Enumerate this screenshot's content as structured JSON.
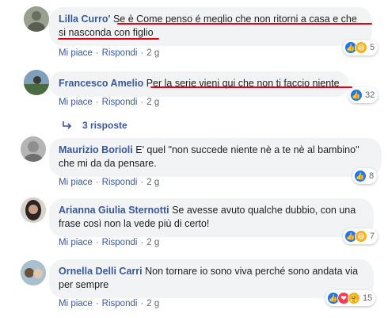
{
  "actions": {
    "like": "Mi piace",
    "reply": "Rispondi",
    "sep": "·"
  },
  "comments": [
    {
      "author": "Lilla Curro'",
      "text_lines": [
        "Se è Come penso é meglio che non ritorni a casa e che",
        "si nasconda con figlio"
      ],
      "time": "2 g",
      "reactions": {
        "icons": [
          "like-icon",
          "haha-icon"
        ],
        "count": "5"
      }
    },
    {
      "author": "Francesco Amelio",
      "text_lines": [
        "Per la serie vieni qui che non ti faccio niente"
      ],
      "time": "2 g",
      "reactions": {
        "icons": [
          "like-icon"
        ],
        "count": "32"
      },
      "replies_label": "3 risposte"
    },
    {
      "author": "Maurizio Borioli",
      "text_lines": [
        "E' quel \"non succede niente nè a te nè al bambino\"",
        "che mi da da pensare."
      ],
      "time": "2 g",
      "reactions": {
        "icons": [
          "like-icon"
        ],
        "count": "8"
      }
    },
    {
      "author": "Arianna Giulia Sternotti",
      "text_lines": [
        "Se avesse avuto qualche dubbio, con una",
        "frase così non la vede più di certo!"
      ],
      "time": "2 g",
      "reactions": {
        "icons": [
          "like-icon",
          "haha-icon"
        ],
        "count": "7"
      }
    },
    {
      "author": "Ornella Delli Carri",
      "text_lines": [
        "Non tornare io sono viva perché sono andata via",
        "per sempre"
      ],
      "time": "2 g",
      "reactions": {
        "icons": [
          "like-icon",
          "love-icon",
          "care-icon"
        ],
        "count": "15"
      }
    }
  ],
  "colors": {
    "link": "#385898",
    "bubble": "#f2f3f5",
    "like": "#1877f2",
    "annotation_red": "#e0001b"
  }
}
